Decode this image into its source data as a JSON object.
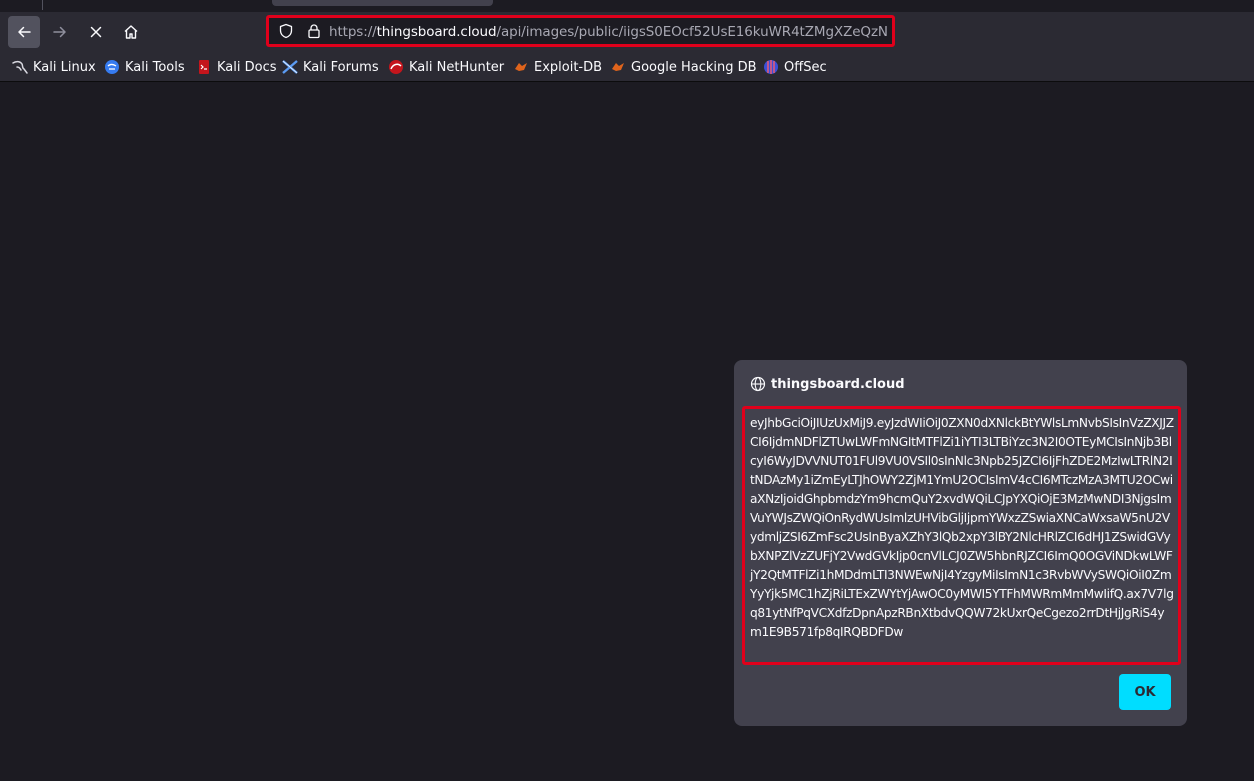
{
  "browser": {
    "url_prefix": "https://",
    "url_domain": "thingsboard.cloud",
    "url_path": "/api/images/public/iigsS0EOcf52UsE16kuWR4tZMgXZeQzN",
    "icons": {
      "back": "arrow-left-icon",
      "forward": "arrow-right-icon",
      "stop": "close-icon",
      "home": "home-icon",
      "tracking": "shield-icon",
      "security": "lock-icon"
    }
  },
  "bookmarks": [
    {
      "label": "Kali Linux",
      "icon": "kali-dragon-icon"
    },
    {
      "label": "Kali Tools",
      "icon": "kali-tools-icon"
    },
    {
      "label": "Kali Docs",
      "icon": "kali-docs-icon"
    },
    {
      "label": "Kali Forums",
      "icon": "kali-forums-icon"
    },
    {
      "label": "Kali NetHunter",
      "icon": "kali-nethunter-icon"
    },
    {
      "label": "Exploit-DB",
      "icon": "exploit-db-icon"
    },
    {
      "label": "Google Hacking DB",
      "icon": "ghdb-icon"
    },
    {
      "label": "OffSec",
      "icon": "offsec-icon"
    }
  ],
  "dialog": {
    "origin": "thingsboard.cloud",
    "message": "eyJhbGciOiJIUzUxMiJ9.eyJzdWIiOiJ0ZXN0dXNlckBtYWlsLmNvbSIsInVzZXJJZCI6IjdmNDFlZTUwLWFmNGItMTFlZi1iYTI3LTBiYzc3N2I0OTEyMCIsInNjb3BlcyI6WyJDVVNUT01FUl9VU0VSIl0sInNlc3Npb25JZCI6IjFhZDE2MzIwLTRlN2ItNDAzMy1iZmEyLTJhOWY2ZjM1YmU2OCIsImV4cCI6MTczMzA3MTU2OCwiaXNzIjoidGhpbmdzYm9hcmQuY2xvdWQiLCJpYXQiOjE3MzMwNDI3NjgsImVuYWJsZWQiOnRydWUsImlzUHVibGljIjpmYWxzZSwiaXNCaWxsaW5nU2VydmljZSI6ZmFsc2UsInByaXZhY3lQb2xpY3lBY2NlcHRlZCI6dHJ1ZSwidGVybXNPZlVzZUFjY2VwdGVkIjp0cnVlLCJ0ZW5hbnRJZCI6ImQ0OGViNDkwLWFjY2QtMTFlZi1hMDdmLTI3NWEwNjI4YzgyMiIsImN1c3RvbWVySWQiOiI0ZmYyYjk5MC1hZjRiLTExZWYtYjAwOC0yMWI5YTFhMWRmMmMwIifQ.ax7V7lgq81ytNfPqVCXdfzDpnApzRBnXtbdvQQW72kUxrQeCgezo2rrDtHjJgRiS4ym1E9B571fp8qIRQBDFDw",
    "ok_label": "OK"
  },
  "colors": {
    "highlight": "#e0001b",
    "accent": "#00ddff",
    "toolbar": "#2b2a33",
    "dialog_bg": "#42414d",
    "page_bg": "#1c1b22"
  }
}
